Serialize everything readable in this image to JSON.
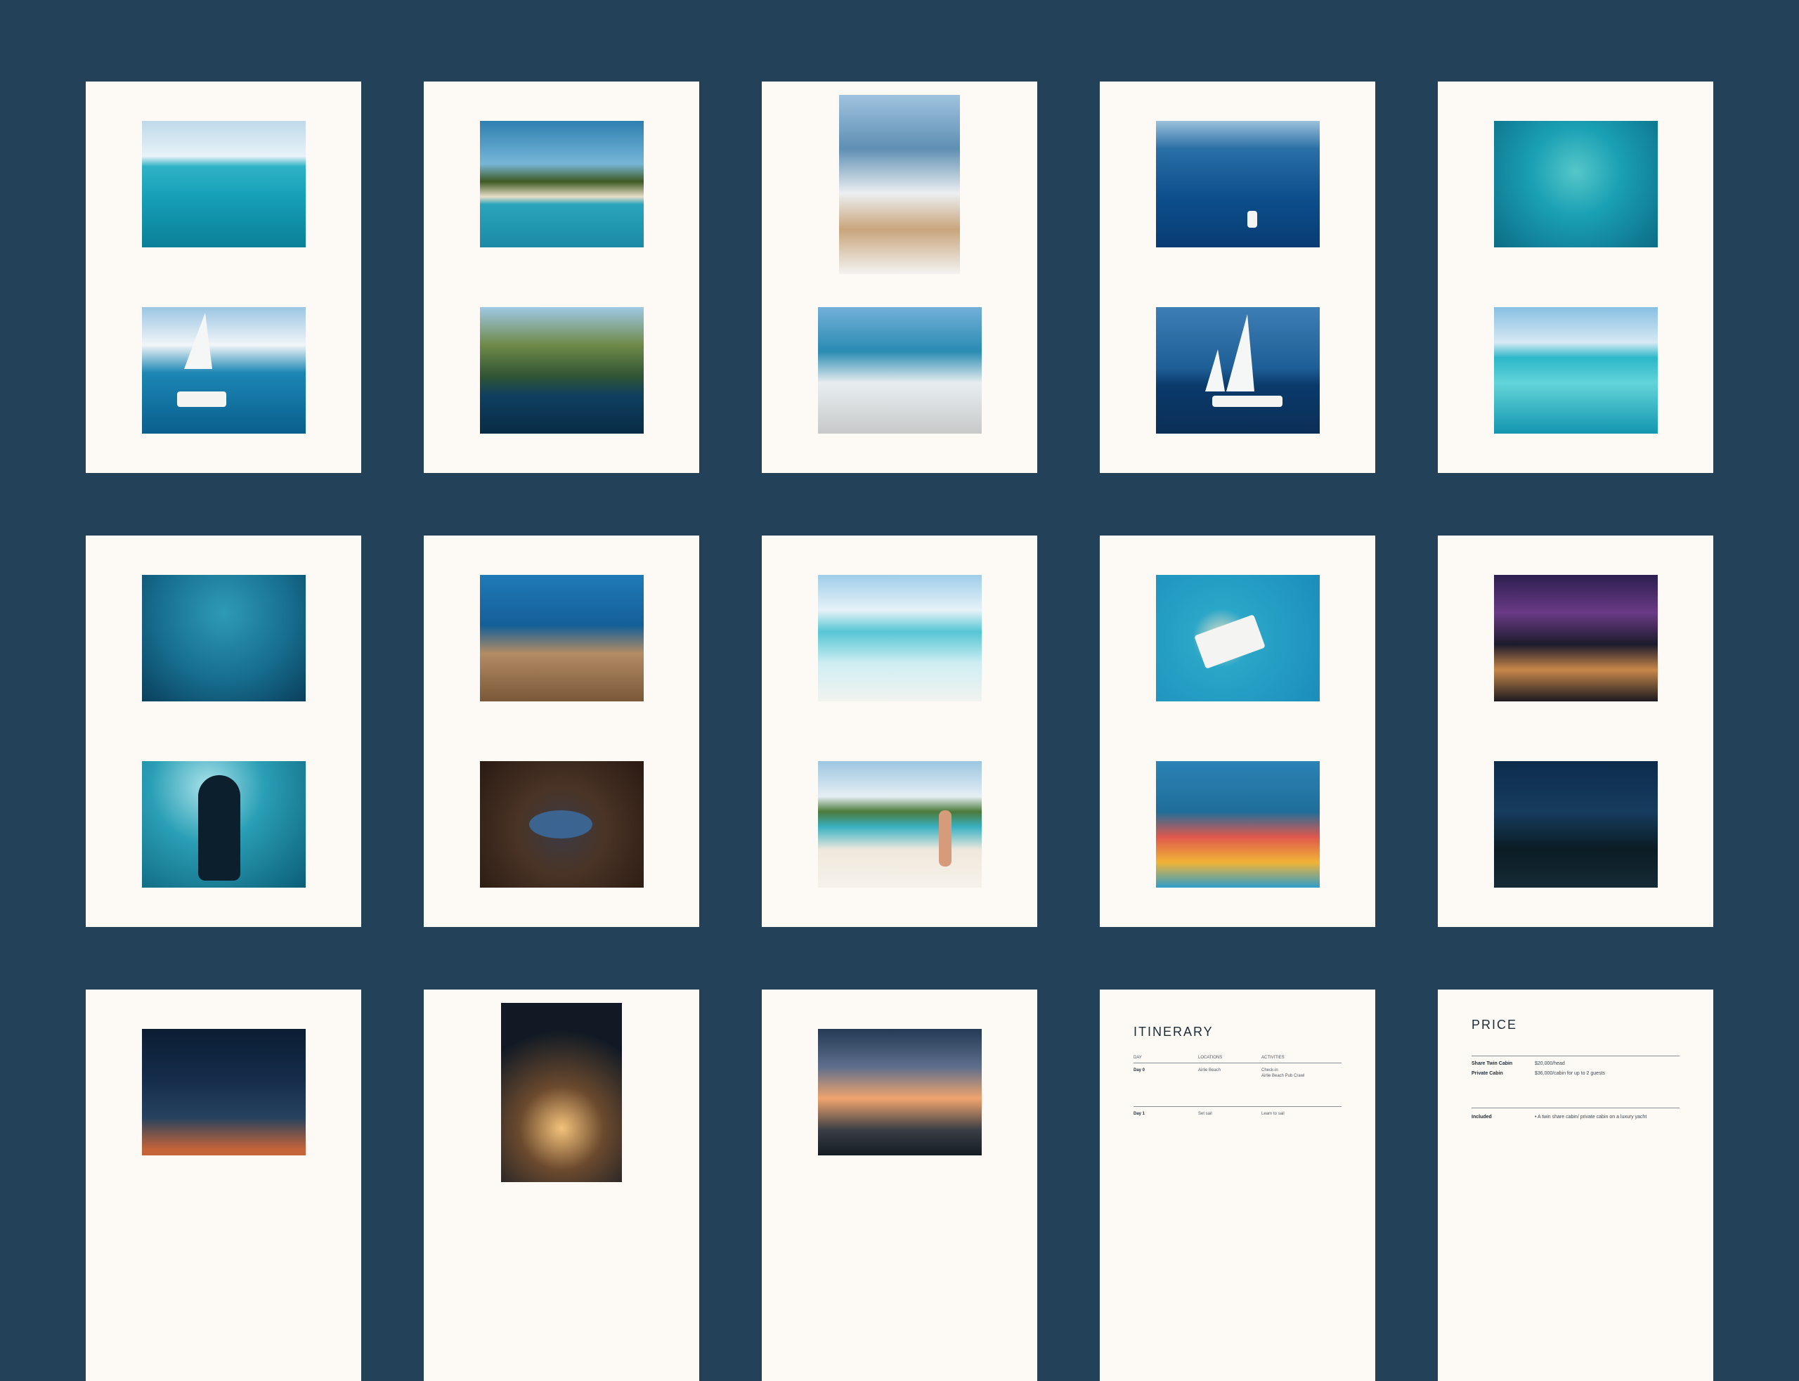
{
  "itinerary": {
    "title": "ITINERARY",
    "headers": [
      "DAY",
      "LOCATIONS",
      "ACTIVITIES"
    ],
    "rows": [
      {
        "day": "Day 0",
        "location": "Airlie Beach",
        "activities": [
          "Check-in",
          "Airlie Beach Pub Crawl"
        ]
      },
      {
        "day": "Day 1",
        "location": "Set sail",
        "activities": [
          "Learn to sail"
        ]
      }
    ]
  },
  "price": {
    "title": "PRICE",
    "rows": [
      {
        "label": "Share Twin Cabin",
        "value": "$20,000/head"
      },
      {
        "label": "Private Cabin",
        "value": "$36,000/cabin for up to 2 guests"
      }
    ],
    "included_label": "Included",
    "included_text": "• A twin share cabin/ private cabin on a luxury yacht"
  }
}
